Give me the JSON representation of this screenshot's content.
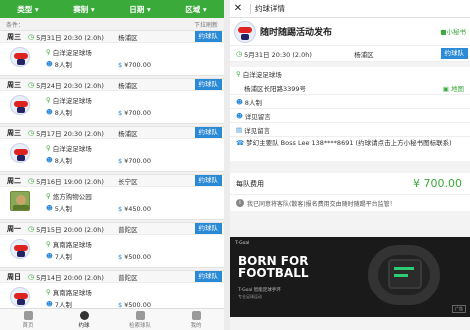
{
  "filters": [
    "类型",
    "赛制",
    "日期",
    "区域"
  ],
  "condition_label": "条件：",
  "pull_hint": "下拉刷新",
  "join_label": "约球队",
  "matches": [
    {
      "weekday": "周三",
      "datetime": "5月31日 20:30 (2.0h)",
      "district": "杨浦区",
      "venue": "白洋淀足球场",
      "players": "8人制",
      "price": "¥700.00",
      "logo": "club"
    },
    {
      "weekday": "周三",
      "datetime": "5月24日 20:30 (2.0h)",
      "district": "杨浦区",
      "venue": "白洋淀足球场",
      "players": "8人制",
      "price": "¥700.00",
      "logo": "club"
    },
    {
      "weekday": "周三",
      "datetime": "5月17日 20:30 (2.0h)",
      "district": "杨浦区",
      "venue": "白洋淀足球场",
      "players": "8人制",
      "price": "¥700.00",
      "logo": "club"
    },
    {
      "weekday": "周二",
      "datetime": "5月16日 19:00 (2.0h)",
      "district": "长宁区",
      "venue": "悠方购物公园",
      "players": "5人制",
      "price": "¥450.00",
      "logo": "photo"
    },
    {
      "weekday": "周一",
      "datetime": "5月15日 20:00 (2.0h)",
      "district": "普陀区",
      "venue": "真南路足球场",
      "players": "7人制",
      "price": "¥500.00",
      "logo": "club"
    },
    {
      "weekday": "周日",
      "datetime": "5月14日 20:00 (2.0h)",
      "district": "普陀区",
      "venue": "真南路足球场",
      "players": "7人制",
      "price": "¥500.00",
      "logo": "club"
    }
  ],
  "bottom_nav": [
    {
      "label": "首页",
      "active": false
    },
    {
      "label": "约球",
      "active": true
    },
    {
      "label": "检索球队",
      "active": false
    },
    {
      "label": "我的",
      "active": false
    }
  ],
  "detail": {
    "header_title": "约球详情",
    "title": "随时随踢活动发布",
    "mini_secretary": "小秘书",
    "datetime": "5月31日 20:30 (2.0h)",
    "district": "杨浦区",
    "join_label": "约球队",
    "venue": "白洋淀足球场",
    "address": "杨浦区长阳路3399号",
    "map_label": "地图",
    "players": "8人制",
    "message1": "详见留言",
    "message2": "详见留言",
    "contact": "梦幻主要队 Boss Lee 138****8691 (约球请点击上方小秘书图标联系)",
    "fee_label": "每队费用",
    "fee": "¥ 700.00",
    "notice": "我已同意将客队(散客)报名费用交由随时随踢平台监管！",
    "ad_brand": "T-Goal",
    "ad_headline1": "BORN FOR",
    "ad_headline2": "FOOTBALL",
    "ad_sub": "T-Goal 智能足球手环",
    "ad_sub2": "专业足球运动",
    "ad_tag": "广告"
  }
}
